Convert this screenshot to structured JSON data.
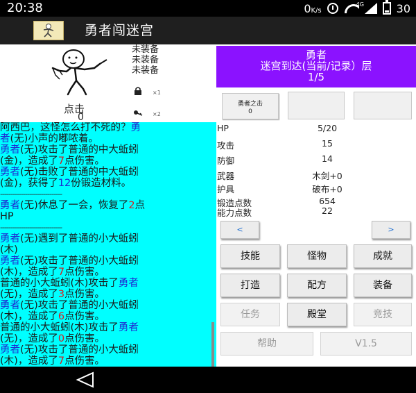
{
  "status_bar": {
    "time": "20:38",
    "data_speed": "0",
    "data_unit": "K/s",
    "network_type": "4G",
    "battery": "30",
    "icons": [
      "alarm-icon",
      "wifi-icon",
      "signal-icon",
      "battery-icon"
    ]
  },
  "app": {
    "title": "勇者闯迷宫",
    "icon": "app-logo-icon"
  },
  "hero_panel": {
    "equipment_slots": [
      "未装备",
      "未装备",
      "未装备"
    ],
    "click_label": "点击",
    "click_count": "0",
    "items": [
      {
        "icon": "lock-icon",
        "count": "×1"
      },
      {
        "icon": "key-icon",
        "count": "×2"
      }
    ]
  },
  "maze_header": {
    "line1": "勇者",
    "line2": "迷宫到达(当前/记录）层",
    "line3": "1/5"
  },
  "hero_tile": {
    "label": "勇者之击",
    "value": "0"
  },
  "stats": [
    {
      "label": "HP",
      "value": "5/20"
    },
    {
      "label": "攻击",
      "value": "15"
    },
    {
      "label": "防御",
      "value": "14"
    },
    {
      "label": "武器",
      "value": "木剑+0"
    },
    {
      "label": "护具",
      "value": "破布+0"
    },
    {
      "label": "锻造点数",
      "value": "654"
    },
    {
      "label": "能力点数",
      "value": "22"
    }
  ],
  "nav": {
    "prev": "<",
    "next": ">"
  },
  "buttons": {
    "skills": "技能",
    "monsters": "怪物",
    "achievements": "成就",
    "forge": "打造",
    "recipes": "配方",
    "equipment": "装备",
    "quests": "任务",
    "hall": "殿堂",
    "arena": "竞技",
    "help": "帮助",
    "version": "V1.5"
  },
  "log": {
    "l1a": "阿西巴，这怪怎么打不死的？",
    "l1b": "勇",
    "l2a": "者",
    "l2b": "(无)小声的嘟哝着。",
    "l3a": "勇者",
    "l3b": "(无)攻击了普通的中大蚯蚓",
    "l4a": "(金)，造成了",
    "l4b": "7",
    "l4c": "点伤害。",
    "l5a": "勇者",
    "l5b": "(无)击败了普通的中大蚯蚓",
    "l6a": "(金)，获得了",
    "l6b": "12",
    "l6c": "份锻造材料。",
    "sep1": "------------------------------",
    "l7a": "勇者",
    "l7b": "(无)休息了一会，恢复了",
    "l7c": "2",
    "l7d": "点",
    "l8": "HP",
    "sep2": "------------------------------",
    "l9a": "勇者",
    "l9b": "(无)遇到了普通的小大蚯蚓",
    "l10": "(木)",
    "l11a": "勇者",
    "l11b": "(无)攻击了普通的小大蚯蚓",
    "l12a": "(木)，造成了",
    "l12b": "7",
    "l12c": "点伤害。",
    "l13a": "普通的小大蚯蚓(木)攻击了",
    "l13b": "勇者",
    "l14a": "(无)，造成了",
    "l14b": "3",
    "l14c": "点伤害。",
    "l15a": "勇者",
    "l15b": "(无)攻击了普通的小大蚯蚓",
    "l16a": "(木)，造成了",
    "l16b": "6",
    "l16c": "点伤害。",
    "l17a": "普通的小大蚯蚓(木)攻击了",
    "l17b": "勇者",
    "l18a": "(无)，造成了",
    "l18b": "0",
    "l18c": "点伤害。",
    "l19a": "勇者",
    "l19b": "(无)攻击了普通的小大蚯蚓",
    "l20a": "(木)，造成了",
    "l20b": "7",
    "l20c": "点伤害。"
  },
  "colors": {
    "purple_header": "#8b12ff",
    "log_background": "#00ffff",
    "hero_text": "#1f2bd1",
    "damage_text": "#d62020"
  }
}
